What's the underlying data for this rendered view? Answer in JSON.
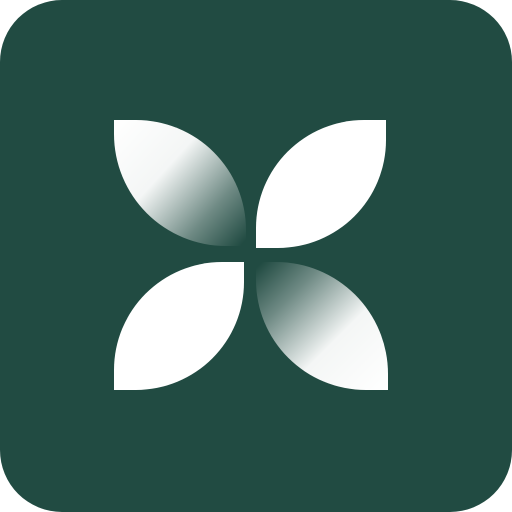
{
  "icon": {
    "name": "four-petal-leaf-logo",
    "colors": {
      "tile_background": "#214b42",
      "petal": "#ffffff"
    }
  }
}
